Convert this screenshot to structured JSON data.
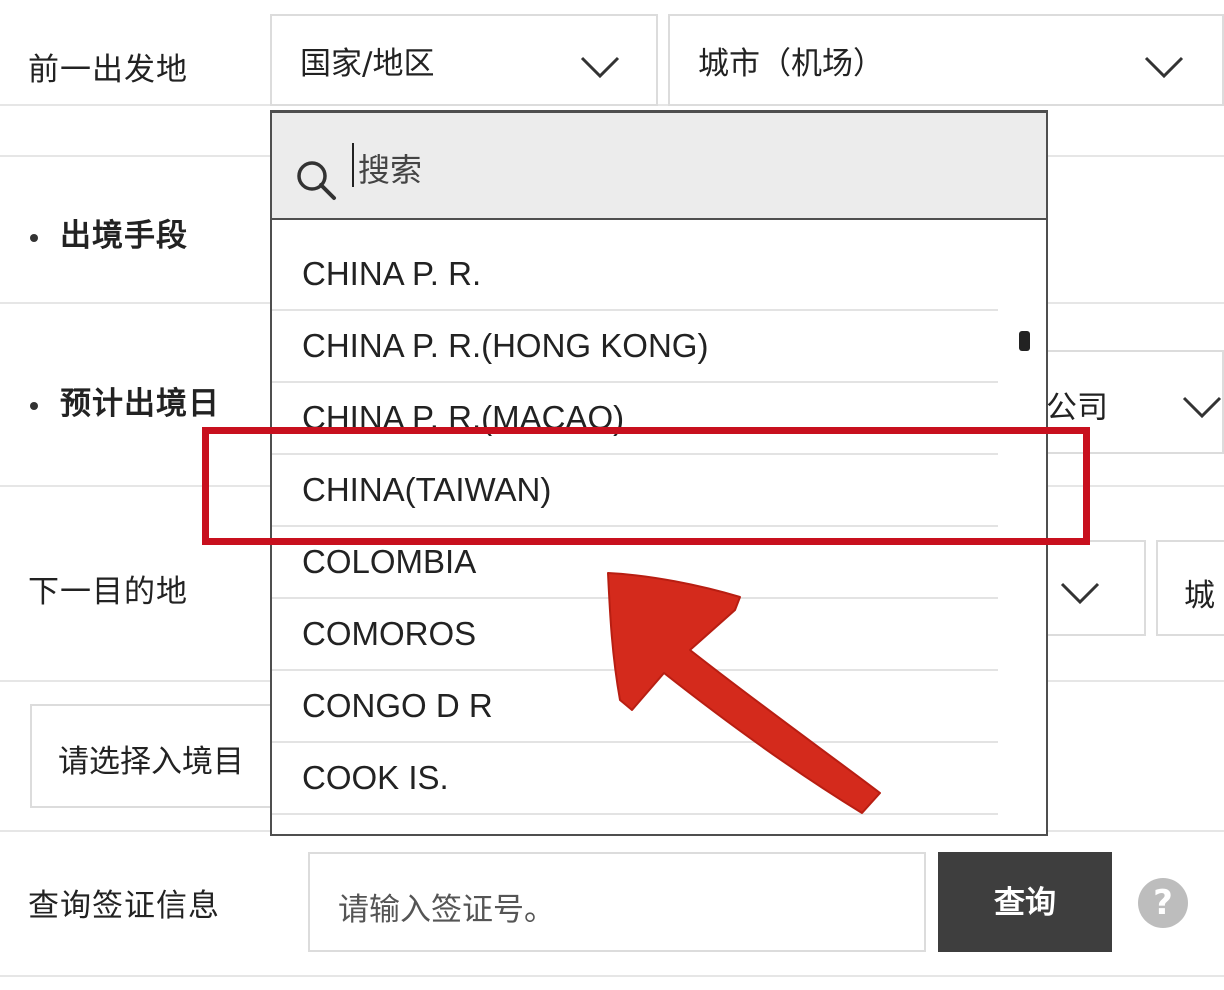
{
  "rows": {
    "prev_origin_label": "前一出发地",
    "exit_method_label": "出境手段",
    "exit_date_label": "预计出境日",
    "next_destination_label": "下一目的地",
    "visa_query_label": "查询签证信息"
  },
  "origin": {
    "country_select": "国家/地区",
    "city_select": "城市（机场）"
  },
  "right_partial": {
    "company_text": "公司",
    "city_partial": "城"
  },
  "entry_select_placeholder": "请选择入境目",
  "visa": {
    "input_placeholder": "请输入签证号。",
    "query_button": "查询",
    "help_icon_text": "?"
  },
  "dropdown": {
    "search_placeholder": "搜索",
    "options": [
      "CHINA P. R.",
      "CHINA P. R.(HONG KONG)",
      "CHINA P. R.(MACAO)",
      "CHINA(TAIWAN)",
      "COLOMBIA",
      "COMOROS",
      "CONGO D R",
      "COOK IS."
    ],
    "highlighted_option": "CHINA(TAIWAN)"
  },
  "colors": {
    "highlight": "#c8101e",
    "arrow": "#d42a1c",
    "button_bg": "#3e3e3e"
  },
  "icons": [
    "chevron-down-icon",
    "search-icon",
    "help-icon",
    "arrow-annotation"
  ]
}
